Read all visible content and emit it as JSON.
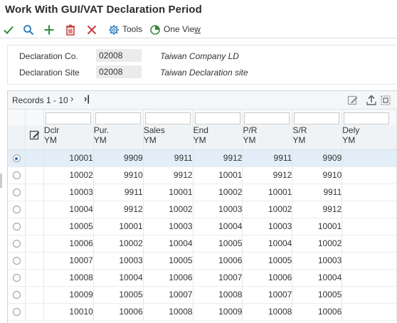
{
  "page": {
    "title": "Work With GUI/VAT Declaration Period"
  },
  "toolbar": {
    "tools_label": "Tools",
    "oneview_label_prefix": "One Vie",
    "oneview_label_underlined": "w",
    "colors": {
      "check": "#2e8b3a",
      "search": "#2a7ab8",
      "add": "#2e8b3a",
      "delete": "#c43a3a",
      "close": "#c43a3a",
      "tools": "#2a7ab8",
      "oneview": "#3c8a3c"
    }
  },
  "form": {
    "co_label": "Declaration Co.",
    "co_value": "02008",
    "co_desc": "Taiwan Company LD",
    "site_label": "Declaration Site",
    "site_value": "02008",
    "site_desc": "Taiwan Declaration site"
  },
  "grid": {
    "records_label": "Records 1 - 10",
    "next_icon": "chevron-right",
    "last_icon": "chevron-last",
    "columns": [
      {
        "line1": "Dclr",
        "line2": "YM"
      },
      {
        "line1": "Pur.",
        "line2": "YM"
      },
      {
        "line1": "Sales",
        "line2": "YM"
      },
      {
        "line1": "End",
        "line2": "YM"
      },
      {
        "line1": "P/R",
        "line2": "YM"
      },
      {
        "line1": "S/R",
        "line2": "YM"
      },
      {
        "line1": "Dely",
        "line2": "YM"
      }
    ],
    "rows": [
      {
        "selected": true,
        "cells": [
          "10001",
          "9909",
          "9911",
          "9912",
          "9911",
          "9909",
          ""
        ]
      },
      {
        "selected": false,
        "cells": [
          "10002",
          "9910",
          "9912",
          "10001",
          "9912",
          "9910",
          ""
        ]
      },
      {
        "selected": false,
        "cells": [
          "10003",
          "9911",
          "10001",
          "10002",
          "10001",
          "9911",
          ""
        ]
      },
      {
        "selected": false,
        "cells": [
          "10004",
          "9912",
          "10002",
          "10003",
          "10002",
          "9912",
          ""
        ]
      },
      {
        "selected": false,
        "cells": [
          "10005",
          "10001",
          "10003",
          "10004",
          "10003",
          "10001",
          ""
        ]
      },
      {
        "selected": false,
        "cells": [
          "10006",
          "10002",
          "10004",
          "10005",
          "10004",
          "10002",
          ""
        ]
      },
      {
        "selected": false,
        "cells": [
          "10007",
          "10003",
          "10005",
          "10006",
          "10005",
          "10003",
          ""
        ]
      },
      {
        "selected": false,
        "cells": [
          "10008",
          "10004",
          "10006",
          "10007",
          "10006",
          "10004",
          ""
        ]
      },
      {
        "selected": false,
        "cells": [
          "10009",
          "10005",
          "10007",
          "10008",
          "10007",
          "10005",
          ""
        ]
      },
      {
        "selected": false,
        "cells": [
          "10010",
          "10006",
          "10008",
          "10009",
          "10008",
          "10006",
          ""
        ]
      }
    ]
  }
}
